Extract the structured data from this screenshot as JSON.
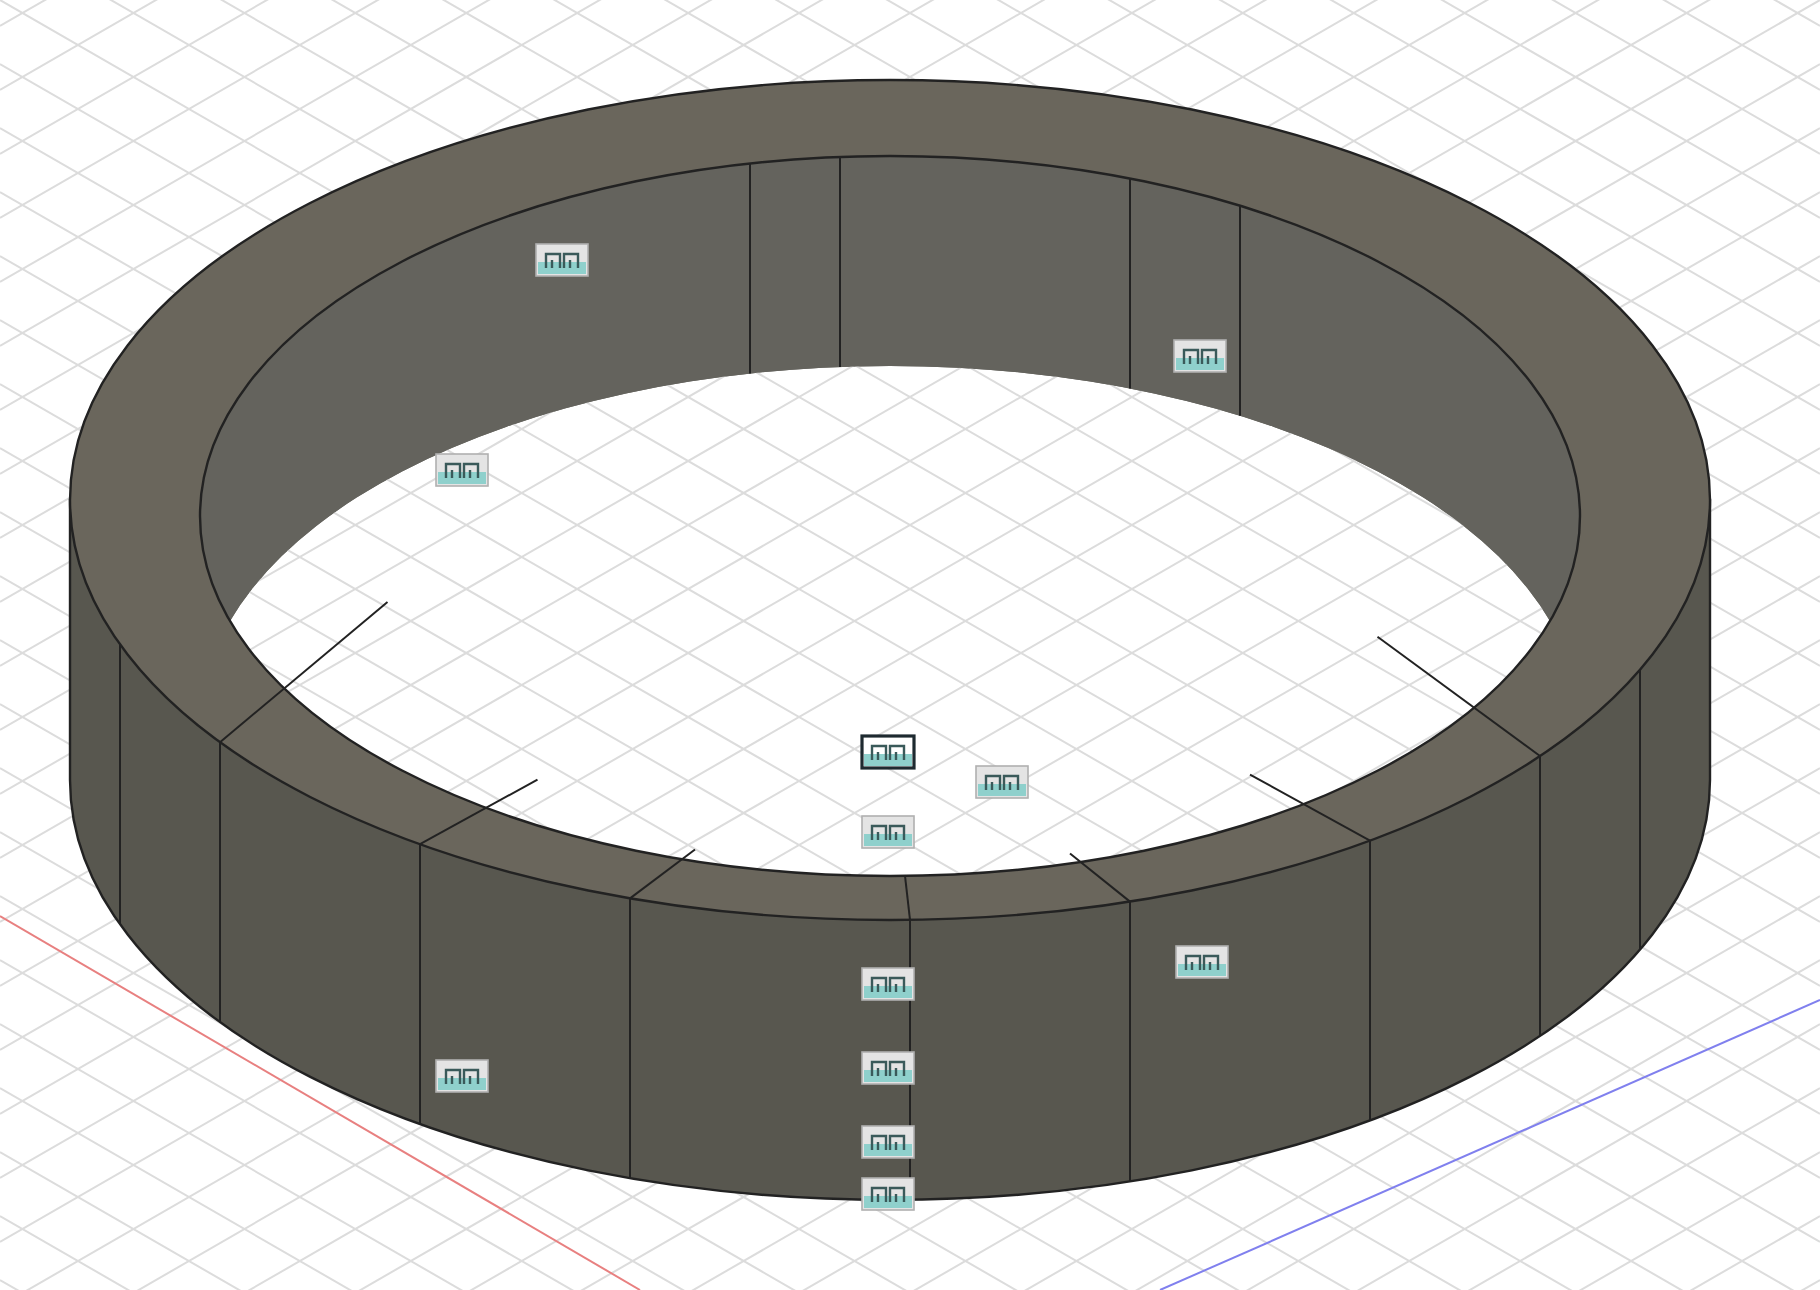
{
  "viewport": {
    "joints": [
      {
        "selected": false
      },
      {
        "selected": false
      },
      {
        "selected": false
      },
      {
        "selected": true
      },
      {
        "selected": false
      },
      {
        "selected": false
      },
      {
        "selected": false
      },
      {
        "selected": false
      },
      {
        "selected": false
      },
      {
        "selected": false
      },
      {
        "selected": false
      },
      {
        "selected": false
      }
    ]
  }
}
